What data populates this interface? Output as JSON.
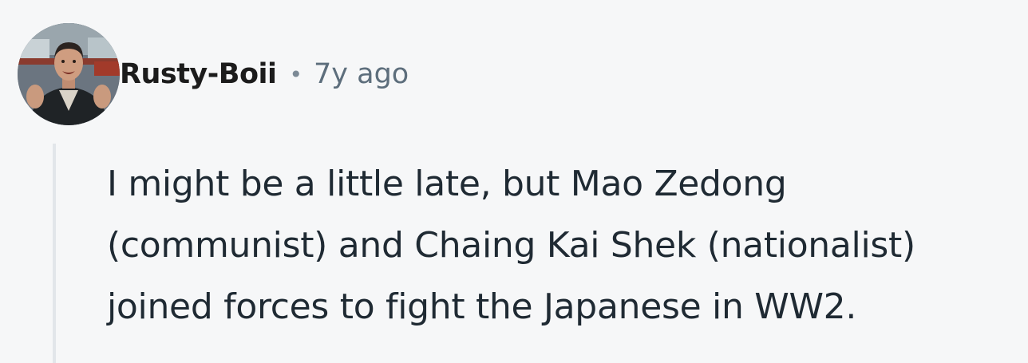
{
  "comment": {
    "author": {
      "username": "Rusty-Boii"
    },
    "separator": "•",
    "timestamp": "7y ago",
    "body_lines": [
      "I might be a little late, but Mao Zedong",
      "(communist) and Chaing Kai Shek (nationalist)",
      "joined forces to fight the Japanese in WW2."
    ]
  },
  "colors": {
    "background": "#f6f7f8",
    "username": "#1c1c1c",
    "timestamp": "#5d6e7c",
    "body_text": "#1f2a33",
    "thread_line": "#e2e6ea"
  }
}
